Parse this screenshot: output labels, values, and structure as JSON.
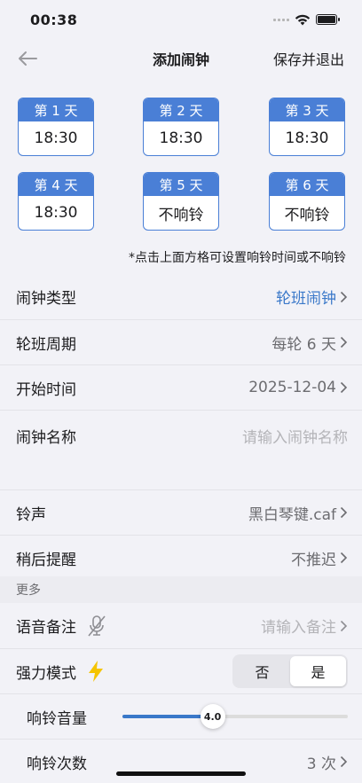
{
  "status_bar": {
    "time": "00:38"
  },
  "nav": {
    "title": "添加闹钟",
    "save_label": "保存并退出"
  },
  "days": [
    {
      "label": "第 1 天",
      "time": "18:30"
    },
    {
      "label": "第 2 天",
      "time": "18:30"
    },
    {
      "label": "第 3 天",
      "time": "18:30"
    },
    {
      "label": "第 4 天",
      "time": "18:30"
    },
    {
      "label": "第 5 天",
      "time": "不响铃"
    },
    {
      "label": "第 6 天",
      "time": "不响铃"
    }
  ],
  "hint": "*点击上面方格可设置响铃时间或不响铃",
  "settings": {
    "alarm_type": {
      "label": "闹钟类型",
      "value": "轮班闹钟"
    },
    "shift_cycle": {
      "label": "轮班周期",
      "value": "每轮 6 天"
    },
    "start_time": {
      "label": "开始时间",
      "value": "2025-12-04"
    },
    "alarm_name": {
      "label": "闹钟名称",
      "placeholder": "请输入闹钟名称"
    },
    "ringtone": {
      "label": "铃声",
      "value": "黑白琴键.caf"
    },
    "snooze": {
      "label": "稍后提醒",
      "value": "不推迟"
    }
  },
  "more": {
    "header": "更多",
    "voice_note": {
      "label": "语音备注",
      "placeholder": "请输入备注",
      "icon": "mic-off-icon"
    },
    "force_mode": {
      "label": "强力模式",
      "icon": "lightning-icon",
      "options": [
        "否",
        "是"
      ],
      "selected": "是"
    },
    "volume": {
      "label": "响铃音量",
      "value": "4.0",
      "level": 0.4
    },
    "ring_count": {
      "label": "响铃次数",
      "value": "3 次"
    }
  },
  "colors": {
    "accent": "#3a78c9",
    "day_header": "#4a7fd6",
    "bolt": "#f5c400"
  }
}
